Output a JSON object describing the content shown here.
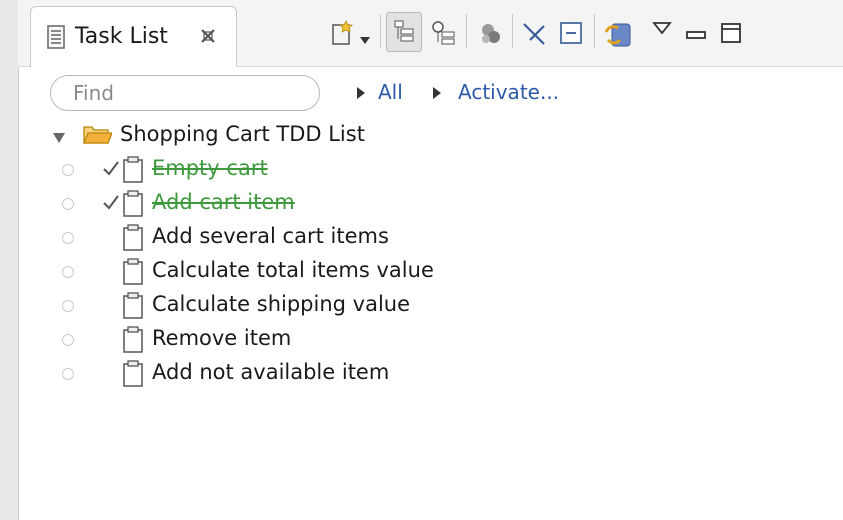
{
  "tab": {
    "title": "Task List",
    "icon": "task-list-icon",
    "close_icon": "close-icon"
  },
  "toolbar": {
    "icons": [
      "new-task-icon",
      "dropdown-arrow-icon",
      "categorized-view-icon",
      "scheduled-view-icon",
      "focus-icon",
      "collapse-all-icon",
      "minimize-icon",
      "sync-icon",
      "view-menu-icon",
      "minimize-view-icon",
      "maximize-view-icon"
    ]
  },
  "filter": {
    "placeholder": "Find",
    "value": "",
    "links": [
      "All",
      "Activate..."
    ]
  },
  "category": {
    "name": "Shopping Cart TDD List",
    "expanded": true
  },
  "tasks": [
    {
      "label": "Empty cart",
      "completed": true
    },
    {
      "label": "Add cart item",
      "completed": true
    },
    {
      "label": "Add several cart items",
      "completed": false
    },
    {
      "label": "Calculate total items value",
      "completed": false
    },
    {
      "label": "Calculate shipping value",
      "completed": false
    },
    {
      "label": "Remove item",
      "completed": false
    },
    {
      "label": "Add not available item",
      "completed": false
    }
  ],
  "colors": {
    "completed_text": "#3f9a3f",
    "link": "#2b5aa8",
    "folder": "#f3b13b"
  }
}
